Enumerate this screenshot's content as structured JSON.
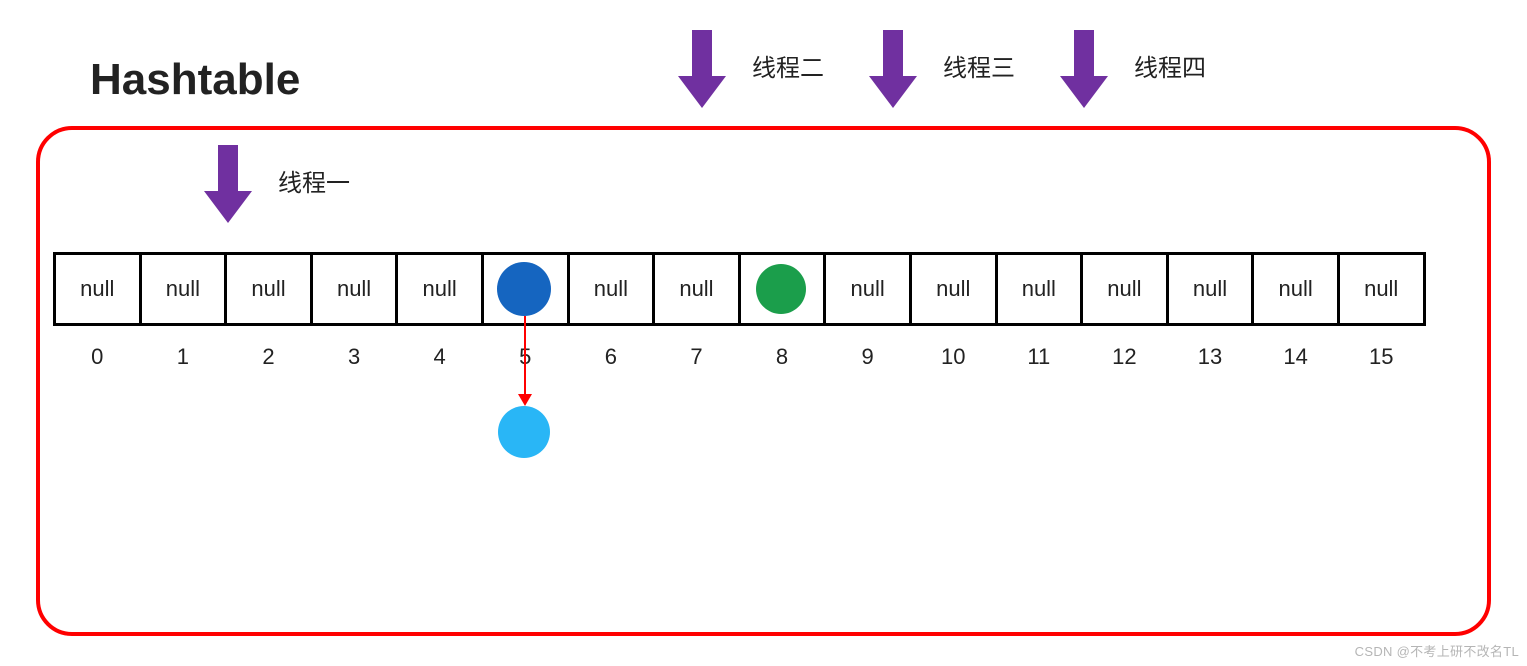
{
  "title": "Hashtable",
  "threads": {
    "one": {
      "label": "线程一"
    },
    "two": {
      "label": "线程二"
    },
    "three": {
      "label": "线程三"
    },
    "four": {
      "label": "线程四"
    }
  },
  "cells": {
    "c0": "null",
    "c1": "null",
    "c2": "null",
    "c3": "null",
    "c4": "null",
    "c5": "",
    "c6": "null",
    "c7": "null",
    "c8": "",
    "c9": "null",
    "c10": "null",
    "c11": "null",
    "c12": "null",
    "c13": "null",
    "c14": "null",
    "c15": "null"
  },
  "indices": {
    "i0": "0",
    "i1": "1",
    "i2": "2",
    "i3": "3",
    "i4": "4",
    "i5": "5",
    "i6": "6",
    "i7": "7",
    "i8": "8",
    "i9": "9",
    "i10": "10",
    "i11": "11",
    "i12": "12",
    "i13": "13",
    "i14": "14",
    "i15": "15"
  },
  "colors": {
    "border": "#ff0000",
    "arrow": "#7030a0",
    "node_head": "#1565c0",
    "node_chain": "#29b6f6",
    "node_single": "#1b9e4b"
  },
  "watermark": "CSDN @不考上研不改名TL",
  "chart_data": {
    "type": "table",
    "title": "Hashtable bucket array with chained nodes and concurrent threads",
    "buckets": 16,
    "bucket_state": [
      "null",
      "null",
      "null",
      "null",
      "null",
      "node",
      "null",
      "null",
      "node",
      "null",
      "null",
      "null",
      "null",
      "null",
      "null",
      "null"
    ],
    "chains": [
      {
        "bucket_index": 5,
        "length": 2,
        "colors": [
          "#1565c0",
          "#29b6f6"
        ]
      },
      {
        "bucket_index": 8,
        "length": 1,
        "colors": [
          "#1b9e4b"
        ]
      }
    ],
    "threads_pointing": [
      {
        "name": "线程一",
        "target_bucket": 2,
        "inside_container": true
      },
      {
        "name": "线程二",
        "target_bucket": null,
        "inside_container": false
      },
      {
        "name": "线程三",
        "target_bucket": null,
        "inside_container": false
      },
      {
        "name": "线程四",
        "target_bucket": null,
        "inside_container": false
      }
    ],
    "container_label": "Hashtable",
    "indices": [
      0,
      1,
      2,
      3,
      4,
      5,
      6,
      7,
      8,
      9,
      10,
      11,
      12,
      13,
      14,
      15
    ]
  }
}
